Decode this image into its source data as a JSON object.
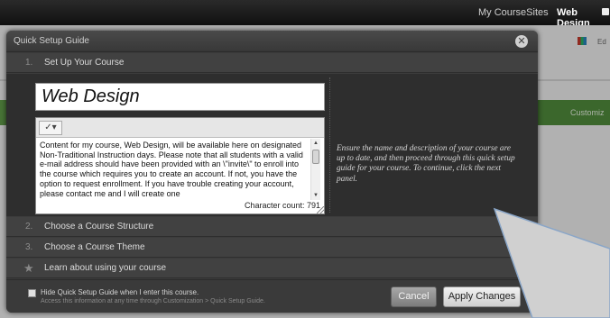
{
  "topbar": {
    "my_coursesites": "My CourseSites",
    "current_course": "Web Design"
  },
  "background": {
    "edit_label": "Ed",
    "customize_label": "Customiz"
  },
  "modal": {
    "title": "Quick Setup Guide",
    "close_icon": "close-icon",
    "steps": [
      {
        "number": "1.",
        "label": "Set Up Your Course"
      },
      {
        "number": "2.",
        "label": "Choose a Course Structure"
      },
      {
        "number": "3.",
        "label": "Choose a Course Theme"
      },
      {
        "number": "",
        "label": "Learn about using your course"
      }
    ],
    "course_title_value": "Web Design",
    "description_text": "Content for my course, Web Design, will be available here on designated Non-Traditional Instruction days. Please note that all students with a valid e-mail address should have been provided with an \\\"invite\\\" to enroll into the course which requires you to create an account. If not, you have the option to request enrollment. If you have trouble creating your account, please contact me and I will create one",
    "character_count": "Character count: 791",
    "help_text": "Ensure the name and description of your course are up to date, and then proceed through this quick setup guide for your course. To continue, click the next panel.",
    "footer": {
      "checkbox_label": "Hide Quick Setup Guide when I enter this course.",
      "checkbox_sub": "Access this information at any time through Customization > Quick Setup Guide.",
      "checkbox_checked": true,
      "cancel_label": "Cancel",
      "apply_label": "Apply Changes"
    }
  }
}
